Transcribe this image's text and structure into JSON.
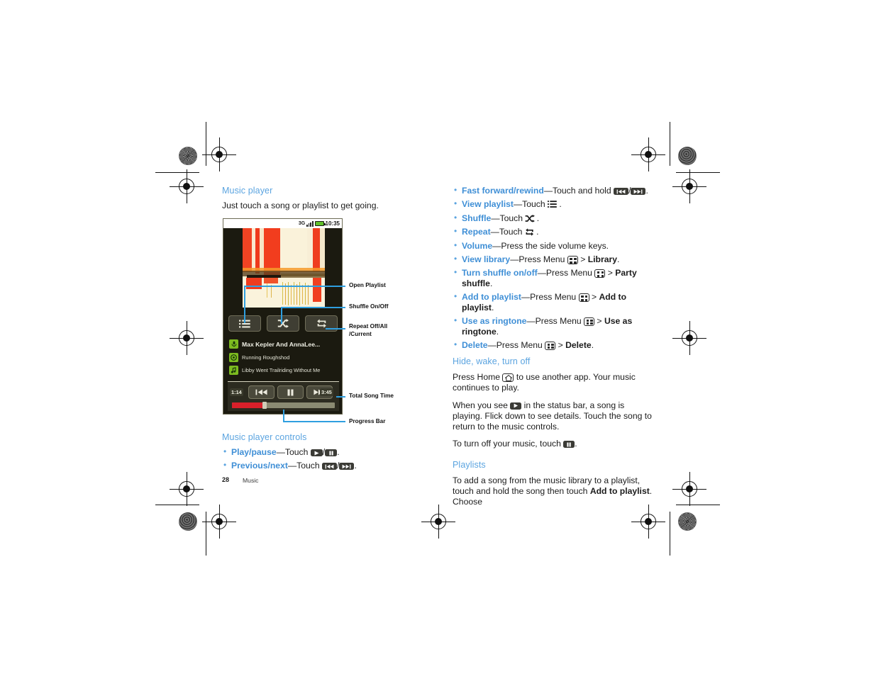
{
  "page": {
    "number": "28",
    "section": "Music"
  },
  "left_column": {
    "heading": "Music player",
    "intro": "Just touch a song or playlist to get going.",
    "controls_heading": "Music player controls",
    "controls": [
      {
        "term": "Play/pause",
        "before": "—Touch ",
        "icons": [
          "play",
          "pause"
        ],
        "after": "."
      },
      {
        "term": "Previous/next",
        "before": "—Touch ",
        "icons": [
          "prev",
          "next"
        ],
        "after": "."
      }
    ]
  },
  "callouts": [
    {
      "label": "Open Playlist"
    },
    {
      "label": "Shuffle On/Off"
    },
    {
      "label": "Repeat Off/All\n/Current"
    },
    {
      "label": "Total Song Time"
    },
    {
      "label": "Progress Bar"
    }
  ],
  "phone": {
    "status_bar": {
      "network": "3G",
      "signal_icon": "signal-bars-icon",
      "battery_icon": "battery-icon",
      "time": "10:35"
    },
    "album_art_alt": "abstract red and cream album artwork",
    "buttons": [
      {
        "name": "open-playlist",
        "icon": "playlist-icon"
      },
      {
        "name": "shuffle",
        "icon": "shuffle-icon"
      },
      {
        "name": "repeat",
        "icon": "repeat-icon"
      }
    ],
    "now_playing": [
      {
        "icon": "microphone-icon",
        "text": "Max Kepler And AnnaLee..."
      },
      {
        "icon": "album-icon",
        "text": "Running Roughshod"
      },
      {
        "icon": "music-note-icon",
        "text": "Libby Went Trailriding Without  Me"
      }
    ],
    "transport": {
      "elapsed": "1:14",
      "total": "3:45",
      "buttons": [
        "previous-icon",
        "pause-icon",
        "next-icon"
      ],
      "progress_percent": 32
    }
  },
  "right_column": {
    "bullets": [
      {
        "term": "Fast forward/rewind",
        "mid": "—Touch and hold ",
        "icons": [
          "prev",
          "next"
        ],
        "tail": "."
      },
      {
        "term": "View playlist",
        "mid": "—Touch ",
        "glyph": "playlist",
        "tail": " ."
      },
      {
        "term": "Shuffle",
        "mid": "—Touch ",
        "glyph": "shuffle",
        "tail": " ."
      },
      {
        "term": "Repeat",
        "mid": "—Touch ",
        "glyph": "repeat",
        "tail": " ."
      },
      {
        "term": "Volume",
        "mid": "—Press the side volume keys.",
        "tail": ""
      },
      {
        "term": "View library",
        "mid": "—Press Menu ",
        "key": "menu",
        "sep": " > ",
        "strong": "Library",
        "tail": "."
      },
      {
        "term": "Turn shuffle on/off",
        "mid": "—Press Menu ",
        "key": "menu",
        "sep": " > ",
        "strong": "Party shuffle",
        "tail": "."
      },
      {
        "term": "Add to playlist",
        "mid": "—Press Menu ",
        "key": "menu",
        "sep": " > ",
        "strong": "Add to playlist",
        "tail": "."
      },
      {
        "term": "Use as ringtone",
        "mid": "—Press Menu ",
        "key": "menu",
        "sep": " > ",
        "strong": "Use as ringtone",
        "tail": "."
      },
      {
        "term": "Delete",
        "mid": "—Press Menu ",
        "key": "menu",
        "sep": " > ",
        "strong": "Delete",
        "tail": "."
      }
    ],
    "hide_heading": "Hide, wake, turn off",
    "hide_p1_a": "Press Home ",
    "hide_p1_b": " to use another app. Your music continues to play.",
    "hide_p2_a": "When you see ",
    "hide_p2_b": " in the status bar, a song is playing. Flick down to see details. Touch the song to return to the music controls.",
    "hide_p3_a": "To turn off your music, touch ",
    "hide_p3_b": ".",
    "playlists_heading": "Playlists",
    "playlists_a": "To add a song from the music library to a playlist, touch and hold the song then touch ",
    "playlists_strong": "Add to playlist",
    "playlists_b": ". Choose"
  },
  "colors": {
    "accent_blue": "#5ba4e0",
    "term_blue": "#3f8fd6",
    "callout_line": "#2f9fe0",
    "progress_red": "#d8202a",
    "icon_green": "#7dbb20"
  }
}
